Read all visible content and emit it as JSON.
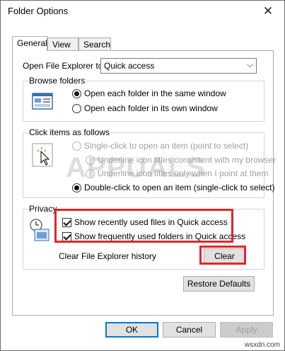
{
  "window": {
    "title": "Folder Options"
  },
  "tabs": [
    {
      "label": "General"
    },
    {
      "label": "View"
    },
    {
      "label": "Search"
    }
  ],
  "general": {
    "open_label": "Open File Explorer to:",
    "open_value": "Quick access",
    "browse": {
      "title": "Browse folders",
      "options": [
        "Open each folder in the same window",
        "Open each folder in its own window"
      ]
    },
    "click": {
      "title": "Click items as follows",
      "single": "Single-click to open an item (point to select)",
      "underline1": "Underline icon titles consistent with my browser",
      "underline2": "Underline icon titles only when I point at them",
      "double": "Double-click to open an item (single-click to select)"
    },
    "privacy": {
      "title": "Privacy",
      "recent_files": "Show recently used files in Quick access",
      "frequent_folders": "Show frequently used folders in Quick access",
      "clear_history": "Clear File Explorer history",
      "clear_button": "Clear"
    },
    "restore_button": "Restore Defaults"
  },
  "buttons": {
    "ok": "OK",
    "cancel": "Cancel",
    "apply": "Apply"
  },
  "watermark": "APPUALS",
  "source": "wsxdn.com"
}
